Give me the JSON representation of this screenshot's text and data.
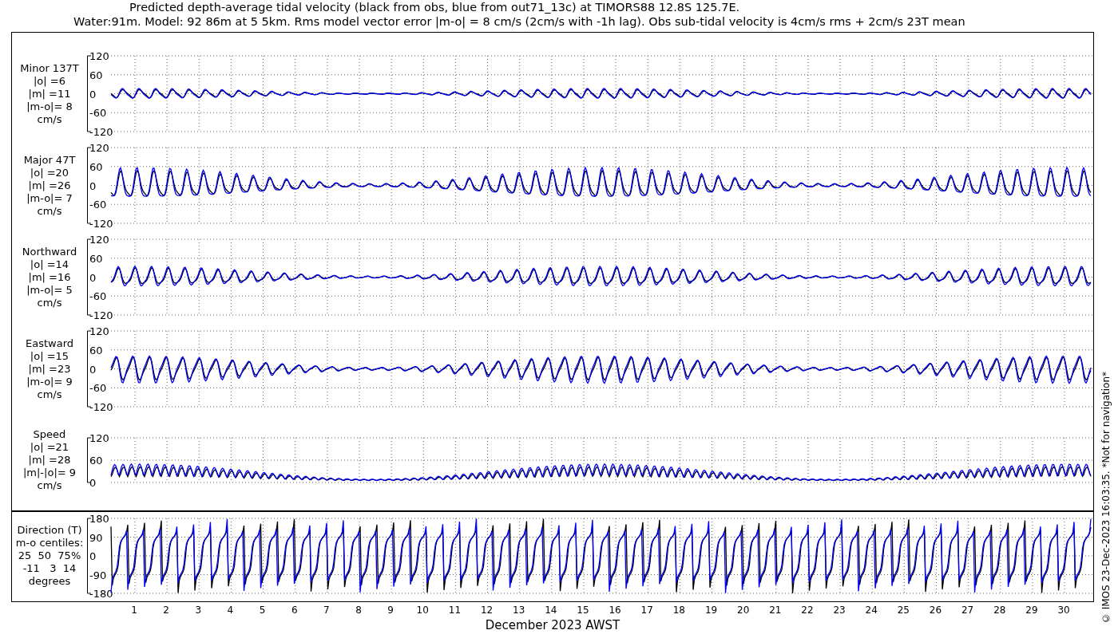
{
  "title_lines": [
    "Predicted depth-average tidal velocity (black from obs, blue from out71_13c) at TIMORS88 12.8S 125.7E.",
    "Water:91m. Model: 92 86m at 5 5km. Rms model vector error |m-o| = 8 cm/s (2cm/s with -1h lag). Obs sub-tidal velocity is 4cm/s rms + 2cm/s 23T mean"
  ],
  "panels": [
    {
      "kind": "velocity",
      "label_lines": [
        "Minor 137T",
        "|o| =6",
        "|m| =11",
        "|m-o|= 8",
        "cm/s"
      ],
      "yticks": [
        "120",
        "60",
        "0",
        "-60",
        "-120"
      ]
    },
    {
      "kind": "velocity",
      "label_lines": [
        "Major 47T",
        "|o| =20",
        "|m| =26",
        "|m-o|= 7",
        "cm/s"
      ],
      "yticks": [
        "120",
        "60",
        "0",
        "-60",
        "-120"
      ]
    },
    {
      "kind": "velocity",
      "label_lines": [
        "Northward",
        "|o| =14",
        "|m| =16",
        "|m-o|= 5",
        "cm/s"
      ],
      "yticks": [
        "120",
        "60",
        "0",
        "-60",
        "-120"
      ]
    },
    {
      "kind": "velocity",
      "label_lines": [
        "Eastward",
        "|o| =15",
        "|m| =23",
        "|m-o|= 9",
        "cm/s"
      ],
      "yticks": [
        "120",
        "60",
        "0",
        "-60",
        "-120"
      ]
    },
    {
      "kind": "speed",
      "label_lines": [
        "Speed",
        "|o| =21",
        "|m| =28",
        "|m|-|o|= 9",
        "cm/s"
      ],
      "yticks": [
        "120",
        "60",
        "0"
      ]
    },
    {
      "kind": "direction",
      "label_lines": [
        "Direction (T)",
        "m-o centiles:",
        "25  50  75%",
        "-11   3  14",
        "degrees"
      ],
      "yticks": [
        "180",
        "90",
        "0",
        "-90",
        "-180"
      ]
    }
  ],
  "x_axis": {
    "ticks": [
      "1",
      "2",
      "3",
      "4",
      "5",
      "6",
      "7",
      "8",
      "9",
      "10",
      "11",
      "12",
      "13",
      "14",
      "15",
      "16",
      "17",
      "18",
      "19",
      "20",
      "21",
      "22",
      "23",
      "24",
      "25",
      "26",
      "27",
      "28",
      "29",
      "30"
    ],
    "label": "December 2023 AWST"
  },
  "side_note": "© IMOS 23-Dec-2023 16:03:35. *Not for navigation*"
}
